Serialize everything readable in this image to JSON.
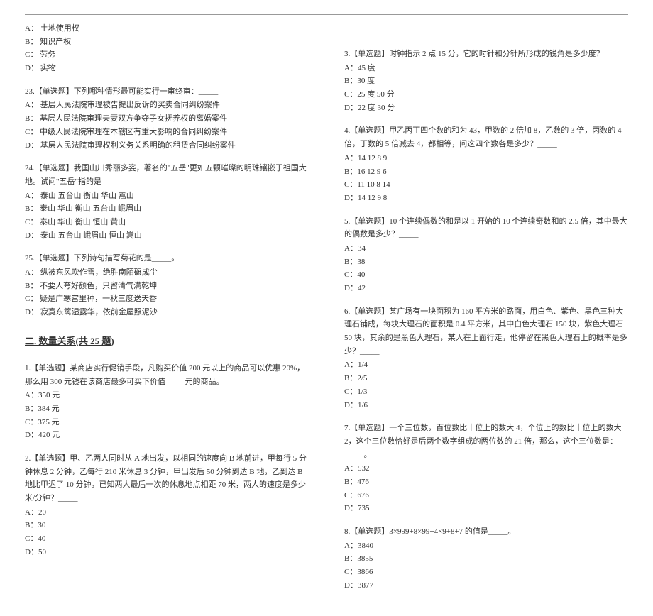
{
  "left": {
    "q22_opts": {
      "a": "A：  土地使用权",
      "b": "B：  知识产权",
      "c": "C：  劳务",
      "d": "D：  实物"
    },
    "q23": {
      "text": "23.【单选题】下列哪种情形最可能实行一审终审：_____",
      "a": "A：  基层人民法院审理被告提出反诉的买卖合同纠纷案件",
      "b": "B：  基层人民法院审理夫妻双方争夺子女抚养权的离婚案件",
      "c": "C：  中级人民法院审理在本辖区有重大影响的合同纠纷案件",
      "d": "D：  基层人民法院审理权利义务关系明确的租赁合同纠纷案件"
    },
    "q24": {
      "text": "24.【单选题】我国山川秀丽多姿，著名的\"五岳\"更如五颗璀璨的明珠镶嵌于祖国大地。试问\"五岳\"指的是_____",
      "a": "A：  泰山  五台山  衡山  华山  嵩山",
      "b": "B：  泰山  华山  衡山  五台山  峨眉山",
      "c": "C：  泰山  华山  衡山  恒山  黄山",
      "d": "D：  泰山  五台山  峨眉山  恒山  嵩山"
    },
    "q25": {
      "text": "25.【单选题】下列诗句描写菊花的是_____。",
      "a": "A：  纵被东风吹作雪，绝胜南陌碾成尘",
      "b": "B：  不要人夸好颜色，只留清气满乾坤",
      "c": "C：  疑是广寒宫里种，一秋三度送天香",
      "d": "D：  寂寞东篱湿露华，依前金屋照泥沙"
    },
    "section2": "二. 数量关系(共 25 题)",
    "q2_1": {
      "text": "1.【单选题】某商店实行促销手段，凡购买价值 200 元以上的商品可以优惠 20%，那么用 300 元钱在该商店最多可买下价值_____元的商品。",
      "a": "A：350 元",
      "b": "B：384 元",
      "c": "C：375 元",
      "d": "D：420 元"
    },
    "q2_2": {
      "text": "2.【单选题】甲、乙两人同时从 A 地出发，以相同的速度向 B 地前进，甲每行 5 分钟休息 2 分钟，乙每行 210 米休息 3 分钟，甲出发后 50 分钟到达 B 地，乙到达 B 地比甲迟了 10 分钟。已知两人最后一次的休息地点相距 70 米，两人的速度是多少米/分钟？_____",
      "a": "A：20",
      "b": "B：30",
      "c": "C：40",
      "d": "D：50"
    }
  },
  "right": {
    "q3": {
      "text": "3.【单选题】时钟指示 2 点 15 分，它的时针和分针所形成的锐角是多少度？_____",
      "a": "A：45 度",
      "b": "B：30 度",
      "c": "C：25 度 50 分",
      "d": "D：22 度 30 分"
    },
    "q4": {
      "text": "4.【单选题】甲乙丙丁四个数的和为 43，甲数的 2 倍加 8，乙数的 3 倍，丙数的 4 倍，丁数的 5 倍减去 4，都相等，问这四个数各是多少？_____",
      "a": "A：14  12  8  9",
      "b": "B：16  12  9  6",
      "c": "C：11  10  8  14",
      "d": "D：14  12  9  8"
    },
    "q5": {
      "text": "5.【单选题】10 个连续偶数的和是以 1 开始的 10 个连续奇数和的 2.5 倍，其中最大的偶数是多少？_____",
      "a": "A：34",
      "b": "B：38",
      "c": "C：40",
      "d": "D：42"
    },
    "q6": {
      "text": "6.【单选题】某广场有一块面积为 160 平方米的路面，用白色、紫色、黑色三种大理石铺成，每块大理石的面积是 0.4 平方米，其中白色大理石 150 块，紫色大理石 50 块，其余的是黑色大理石，某人在上面行走，他停留在黑色大理石上的概率是多少？_____",
      "a": "A：1/4",
      "b": "B：2/5",
      "c": "C：1/3",
      "d": "D：1/6"
    },
    "q7": {
      "text": "7.【单选题】一个三位数，百位数比十位上的数大 4，个位上的数比十位上的数大 2，这个三位数恰好是后两个数字组成的两位数的 21 倍，那么，这个三位数是：_____。",
      "a": "A：532",
      "b": "B：476",
      "c": "C：676",
      "d": "D：735"
    },
    "q8": {
      "text": "8.【单选题】3×999+8×99+4×9+8+7 的值是_____。",
      "a": "A：3840",
      "b": "B：3855",
      "c": "C：3866",
      "d": "D：3877"
    }
  }
}
